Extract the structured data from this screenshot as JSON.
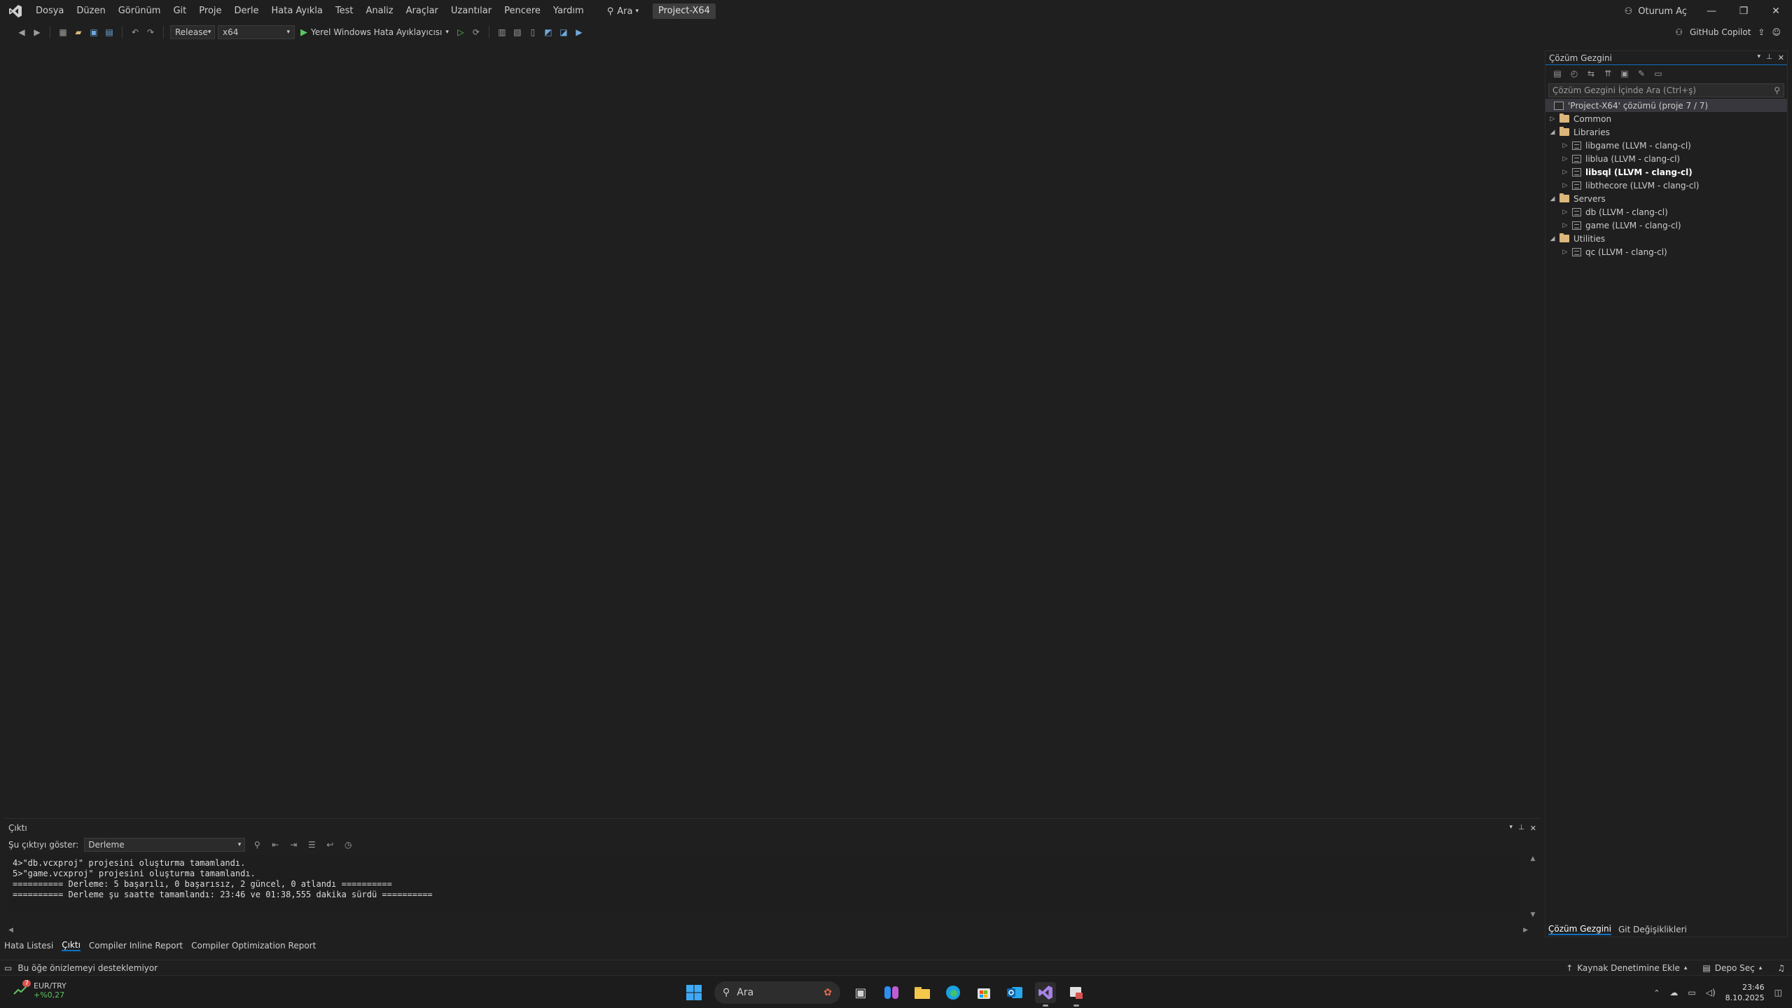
{
  "menu": {
    "items": [
      "Dosya",
      "Düzen",
      "Görünüm",
      "Git",
      "Proje",
      "Derle",
      "Hata Ayıkla",
      "Test",
      "Analiz",
      "Araçlar",
      "Uzantılar",
      "Pencere",
      "Yardım"
    ],
    "search_label": "Ara",
    "project_badge": "Project-X64",
    "signin_label": "Oturum Aç"
  },
  "toolbar": {
    "config": "Release",
    "platform": "x64",
    "run_label": "Yerel Windows Hata Ayıklayıcısı",
    "copilot_label": "GitHub Copilot"
  },
  "solution_explorer": {
    "title": "Çözüm Gezgini",
    "search_placeholder": "Çözüm Gezgini İçinde Ara (Ctrl+ş)",
    "solution": "'Project-X64' çözümü (proje 7 / 7)",
    "folders": [
      {
        "name": "Common",
        "expanded": false,
        "projects": []
      },
      {
        "name": "Libraries",
        "expanded": true,
        "projects": [
          {
            "name": "libgame (LLVM - clang-cl)",
            "bold": false
          },
          {
            "name": "liblua (LLVM - clang-cl)",
            "bold": false
          },
          {
            "name": "libsql (LLVM - clang-cl)",
            "bold": true
          },
          {
            "name": "libthecore (LLVM - clang-cl)",
            "bold": false
          }
        ]
      },
      {
        "name": "Servers",
        "expanded": true,
        "projects": [
          {
            "name": "db (LLVM - clang-cl)",
            "bold": false
          },
          {
            "name": "game (LLVM - clang-cl)",
            "bold": false
          }
        ]
      },
      {
        "name": "Utilities",
        "expanded": true,
        "projects": [
          {
            "name": "qc (LLVM - clang-cl)",
            "bold": false
          }
        ]
      }
    ],
    "tabs": [
      "Çözüm Gezgini",
      "Git Değişiklikleri"
    ]
  },
  "output": {
    "title": "Çıktı",
    "show_label": "Şu çıktıyı göster:",
    "source": "Derleme",
    "lines": [
      "4>\"db.vcxproj\" projesini oluşturma tamamlandı.",
      "5>\"game.vcxproj\" projesini oluşturma tamamlandı.",
      "========== Derleme: 5 başarılı, 0 başarısız, 2 güncel, 0 atlandı ==========",
      "========== Derleme şu saatte tamamlandı: 23:46 ve 01:38,555 dakika sürdü =========="
    ]
  },
  "bottom_tabs": [
    "Hata Listesi",
    "Çıktı",
    "Compiler Inline Report",
    "Compiler Optimization Report"
  ],
  "status": {
    "message": "Bu öğe önizlemeyi desteklemiyor",
    "source_control": "Kaynak Denetimine Ekle",
    "repo": "Depo Seç"
  },
  "taskbar": {
    "ticker_symbol": "EUR/TRY",
    "ticker_change": "+%0,27",
    "ticker_badge": "7",
    "search_label": "Ara",
    "time": "23:46",
    "date": "8.10.2025"
  },
  "colors": {
    "accent": "#0e70c0",
    "vs_purple": "#8a6fd8",
    "positive": "#5fc25f"
  }
}
